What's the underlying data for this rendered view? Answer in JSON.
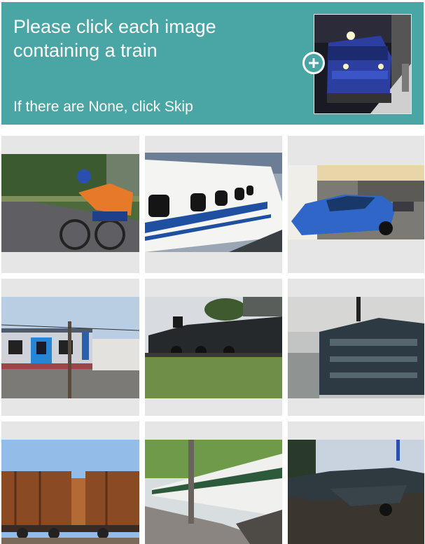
{
  "challenge": {
    "prompt": "Please click each image containing a train",
    "skip_hint": "If there are None, click Skip"
  },
  "colors": {
    "header_bg": "#4aa5a5",
    "tile_bg": "#e6e6e6",
    "text": "#ffffff"
  },
  "icons": {
    "example_expand": "plus-icon"
  }
}
